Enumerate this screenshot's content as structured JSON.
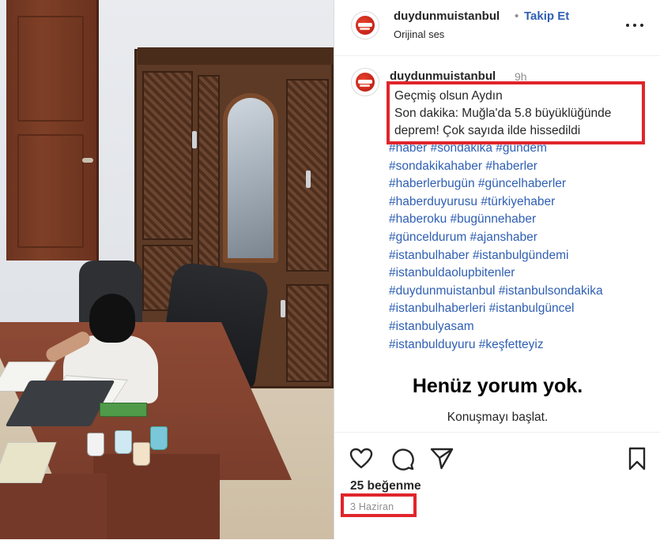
{
  "post": {
    "username": "duydunmuistanbul",
    "separator": "•",
    "follow_label": "Takip Et",
    "audio_label": "Orijinal ses"
  },
  "caption": {
    "username": "duydunmuistanbul",
    "time": "9h",
    "highlight_lines": [
      "Geçmiş olsun Aydın",
      "Son dakika: Muğla'da 5.8 büyüklüğünde",
      "deprem! Çok sayıda ilde hissedildi"
    ],
    "hashtag_lines": [
      "#haber #sondakika #gündem",
      "#sondakikahaber #haberler",
      "#haberlerbugün #güncelhaberler",
      "#haberduyurusu #türkiyehaber",
      "#haberoku #bugünnehaber",
      "#günceldurum #ajanshaber",
      "#istanbulhaber #istanbulgündemi",
      "#istanbuldaolupbitenler",
      "#duydunmuistanbul #istanbulsondakika",
      "#istanbulhaberleri #istanbulgüncel",
      "#istanbulyasam",
      "#istanbulduyuru #keşfetteyiz"
    ]
  },
  "comments": {
    "empty_title": "Henüz yorum yok.",
    "empty_subtitle": "Konuşmayı başlat."
  },
  "stats": {
    "likes": "25 beğenme",
    "date": "3 Haziran"
  },
  "icons": {
    "like": "heart-icon",
    "comment": "comment-icon",
    "share": "send-icon",
    "save": "bookmark-icon",
    "more": "more-options-icon"
  },
  "colors": {
    "link_blue": "#2f5fb3",
    "highlight_red": "#e0252b",
    "muted_text": "#8e8e8e"
  }
}
